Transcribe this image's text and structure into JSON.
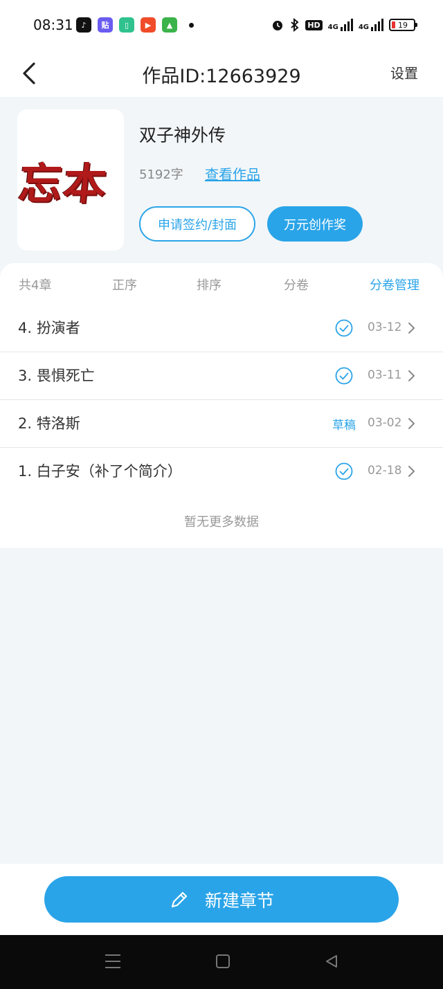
{
  "status_bar": {
    "time": "08:31",
    "apps": [
      {
        "name": "tiktok",
        "glyph": "♪",
        "color": "#111111"
      },
      {
        "name": "tieba",
        "glyph": "贴",
        "color": "#6a5cf0"
      },
      {
        "name": "battery-app",
        "glyph": "▯",
        "color": "#2fc28e"
      },
      {
        "name": "video-app",
        "glyph": "▶",
        "color": "#f04c2a"
      },
      {
        "name": "game-app",
        "glyph": "▲",
        "color": "#3bb34a"
      }
    ],
    "hd_label": "HD",
    "net1": "4G",
    "net2": "4G",
    "battery_level": "19"
  },
  "nav": {
    "title": "作品ID:12663929",
    "settings": "设置"
  },
  "book": {
    "cover_text": "忘本",
    "title": "双子神外传",
    "word_count": "5192字",
    "view_works": "查看作品",
    "apply_button": "申请签约/封面",
    "award_button": "万元创作奖"
  },
  "toolbar": {
    "count": "共4章",
    "order": "正序",
    "sort": "排序",
    "volume": "分卷",
    "volume_manage": "分卷管理"
  },
  "chapters": [
    {
      "title": "4. 扮演者",
      "status": "published",
      "date": "03-12"
    },
    {
      "title": "3. 畏惧死亡",
      "status": "published",
      "date": "03-11"
    },
    {
      "title": "2. 特洛斯",
      "status": "草稿",
      "date": "03-02"
    },
    {
      "title": "1. 白子安（补了个简介）",
      "status": "published",
      "date": "02-18"
    }
  ],
  "no_more_text": "暂无更多数据",
  "new_chapter_button": "新建章节",
  "colors": {
    "accent": "#2aa4e8",
    "background": "#f2f6f9",
    "cover_red": "#b11a1a"
  }
}
